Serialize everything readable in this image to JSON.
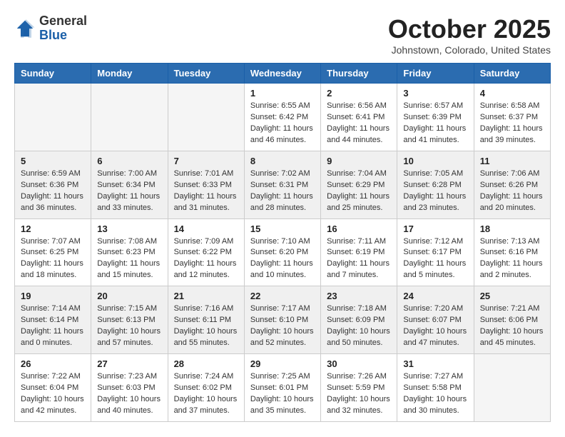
{
  "header": {
    "logo_general": "General",
    "logo_blue": "Blue",
    "month_title": "October 2025",
    "location": "Johnstown, Colorado, United States"
  },
  "days_of_week": [
    "Sunday",
    "Monday",
    "Tuesday",
    "Wednesday",
    "Thursday",
    "Friday",
    "Saturday"
  ],
  "weeks": [
    [
      {
        "day": "",
        "info": ""
      },
      {
        "day": "",
        "info": ""
      },
      {
        "day": "",
        "info": ""
      },
      {
        "day": "1",
        "info": "Sunrise: 6:55 AM\nSunset: 6:42 PM\nDaylight: 11 hours\nand 46 minutes."
      },
      {
        "day": "2",
        "info": "Sunrise: 6:56 AM\nSunset: 6:41 PM\nDaylight: 11 hours\nand 44 minutes."
      },
      {
        "day": "3",
        "info": "Sunrise: 6:57 AM\nSunset: 6:39 PM\nDaylight: 11 hours\nand 41 minutes."
      },
      {
        "day": "4",
        "info": "Sunrise: 6:58 AM\nSunset: 6:37 PM\nDaylight: 11 hours\nand 39 minutes."
      }
    ],
    [
      {
        "day": "5",
        "info": "Sunrise: 6:59 AM\nSunset: 6:36 PM\nDaylight: 11 hours\nand 36 minutes."
      },
      {
        "day": "6",
        "info": "Sunrise: 7:00 AM\nSunset: 6:34 PM\nDaylight: 11 hours\nand 33 minutes."
      },
      {
        "day": "7",
        "info": "Sunrise: 7:01 AM\nSunset: 6:33 PM\nDaylight: 11 hours\nand 31 minutes."
      },
      {
        "day": "8",
        "info": "Sunrise: 7:02 AM\nSunset: 6:31 PM\nDaylight: 11 hours\nand 28 minutes."
      },
      {
        "day": "9",
        "info": "Sunrise: 7:04 AM\nSunset: 6:29 PM\nDaylight: 11 hours\nand 25 minutes."
      },
      {
        "day": "10",
        "info": "Sunrise: 7:05 AM\nSunset: 6:28 PM\nDaylight: 11 hours\nand 23 minutes."
      },
      {
        "day": "11",
        "info": "Sunrise: 7:06 AM\nSunset: 6:26 PM\nDaylight: 11 hours\nand 20 minutes."
      }
    ],
    [
      {
        "day": "12",
        "info": "Sunrise: 7:07 AM\nSunset: 6:25 PM\nDaylight: 11 hours\nand 18 minutes."
      },
      {
        "day": "13",
        "info": "Sunrise: 7:08 AM\nSunset: 6:23 PM\nDaylight: 11 hours\nand 15 minutes."
      },
      {
        "day": "14",
        "info": "Sunrise: 7:09 AM\nSunset: 6:22 PM\nDaylight: 11 hours\nand 12 minutes."
      },
      {
        "day": "15",
        "info": "Sunrise: 7:10 AM\nSunset: 6:20 PM\nDaylight: 11 hours\nand 10 minutes."
      },
      {
        "day": "16",
        "info": "Sunrise: 7:11 AM\nSunset: 6:19 PM\nDaylight: 11 hours\nand 7 minutes."
      },
      {
        "day": "17",
        "info": "Sunrise: 7:12 AM\nSunset: 6:17 PM\nDaylight: 11 hours\nand 5 minutes."
      },
      {
        "day": "18",
        "info": "Sunrise: 7:13 AM\nSunset: 6:16 PM\nDaylight: 11 hours\nand 2 minutes."
      }
    ],
    [
      {
        "day": "19",
        "info": "Sunrise: 7:14 AM\nSunset: 6:14 PM\nDaylight: 11 hours\nand 0 minutes."
      },
      {
        "day": "20",
        "info": "Sunrise: 7:15 AM\nSunset: 6:13 PM\nDaylight: 10 hours\nand 57 minutes."
      },
      {
        "day": "21",
        "info": "Sunrise: 7:16 AM\nSunset: 6:11 PM\nDaylight: 10 hours\nand 55 minutes."
      },
      {
        "day": "22",
        "info": "Sunrise: 7:17 AM\nSunset: 6:10 PM\nDaylight: 10 hours\nand 52 minutes."
      },
      {
        "day": "23",
        "info": "Sunrise: 7:18 AM\nSunset: 6:09 PM\nDaylight: 10 hours\nand 50 minutes."
      },
      {
        "day": "24",
        "info": "Sunrise: 7:20 AM\nSunset: 6:07 PM\nDaylight: 10 hours\nand 47 minutes."
      },
      {
        "day": "25",
        "info": "Sunrise: 7:21 AM\nSunset: 6:06 PM\nDaylight: 10 hours\nand 45 minutes."
      }
    ],
    [
      {
        "day": "26",
        "info": "Sunrise: 7:22 AM\nSunset: 6:04 PM\nDaylight: 10 hours\nand 42 minutes."
      },
      {
        "day": "27",
        "info": "Sunrise: 7:23 AM\nSunset: 6:03 PM\nDaylight: 10 hours\nand 40 minutes."
      },
      {
        "day": "28",
        "info": "Sunrise: 7:24 AM\nSunset: 6:02 PM\nDaylight: 10 hours\nand 37 minutes."
      },
      {
        "day": "29",
        "info": "Sunrise: 7:25 AM\nSunset: 6:01 PM\nDaylight: 10 hours\nand 35 minutes."
      },
      {
        "day": "30",
        "info": "Sunrise: 7:26 AM\nSunset: 5:59 PM\nDaylight: 10 hours\nand 32 minutes."
      },
      {
        "day": "31",
        "info": "Sunrise: 7:27 AM\nSunset: 5:58 PM\nDaylight: 10 hours\nand 30 minutes."
      },
      {
        "day": "",
        "info": ""
      }
    ]
  ]
}
